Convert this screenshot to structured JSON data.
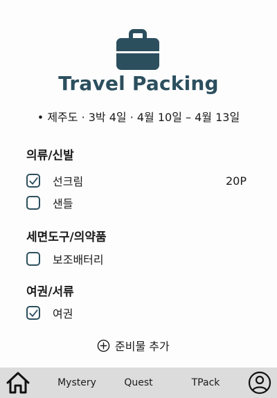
{
  "header": {
    "icon": "briefcase-icon",
    "title": "Travel Packing",
    "trip_info": "• 제주도 · 3박 4일 · 4월 10일 – 4월 13일"
  },
  "sections": [
    {
      "title": "의류/신발",
      "items": [
        {
          "label": "선크림",
          "checked": true,
          "points": "20P"
        },
        {
          "label": "샌들",
          "checked": false,
          "points": ""
        }
      ]
    },
    {
      "title": "세면도구/의약품",
      "items": [
        {
          "label": "보조배터리",
          "checked": false,
          "points": ""
        }
      ]
    },
    {
      "title": "여권/서류",
      "items": [
        {
          "label": "여권",
          "checked": true,
          "points": ""
        }
      ]
    }
  ],
  "add_item": {
    "icon": "plus-circle-icon",
    "label": "준비물 추가"
  },
  "bottom_nav": {
    "home_icon": "home-icon",
    "items": [
      "Mystery",
      "Quest",
      "TPack"
    ],
    "profile_icon": "user-icon"
  },
  "colors": {
    "accent": "#2c4f5e",
    "nav_background": "#dcdcdc",
    "background": "#fdfdfd"
  }
}
